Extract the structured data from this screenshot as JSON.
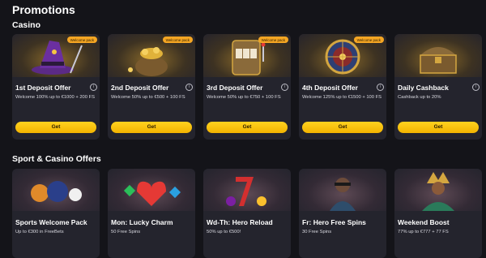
{
  "page": {
    "title": "Promotions"
  },
  "casino": {
    "title": "Casino",
    "cards": [
      {
        "title": "1st Deposit Offer",
        "desc": "Welcome 100% up to €1000 + 200 FS",
        "badge": "Welcome pack",
        "button": "Get"
      },
      {
        "title": "2nd Deposit Offer",
        "desc": "Welcome 50% up to €500 + 100 FS",
        "badge": "Welcome pack",
        "button": "Get"
      },
      {
        "title": "3rd Deposit Offer",
        "desc": "Welcome 50% up to €750 + 100 FS",
        "badge": "Welcome pack",
        "button": "Get"
      },
      {
        "title": "4th Deposit Offer",
        "desc": "Welcome 125% up to €1500 + 100 FS",
        "badge": "Welcome pack",
        "button": "Get"
      },
      {
        "title": "Daily Cashback",
        "desc": "Cashback up to 20%",
        "button": "Get"
      }
    ]
  },
  "sport": {
    "title": "Sport & Casino Offers",
    "cards": [
      {
        "title": "Sports Welcome Pack",
        "desc": "Up to €300 in FreeBets"
      },
      {
        "title": "Mon: Lucky Charm",
        "desc": "50 Free Spins"
      },
      {
        "title": "Wd-Th: Hero Reload",
        "desc": "50% up to €500!"
      },
      {
        "title": "Fr: Hero Free Spins",
        "desc": "30 Free Spins"
      },
      {
        "title": "Weekend Boost",
        "desc": "77% up to €777 + 77 FS"
      }
    ]
  },
  "icons": {
    "info": "i"
  },
  "colors": {
    "accent": "#f5b800",
    "card": "#24242d",
    "background": "#141419"
  }
}
